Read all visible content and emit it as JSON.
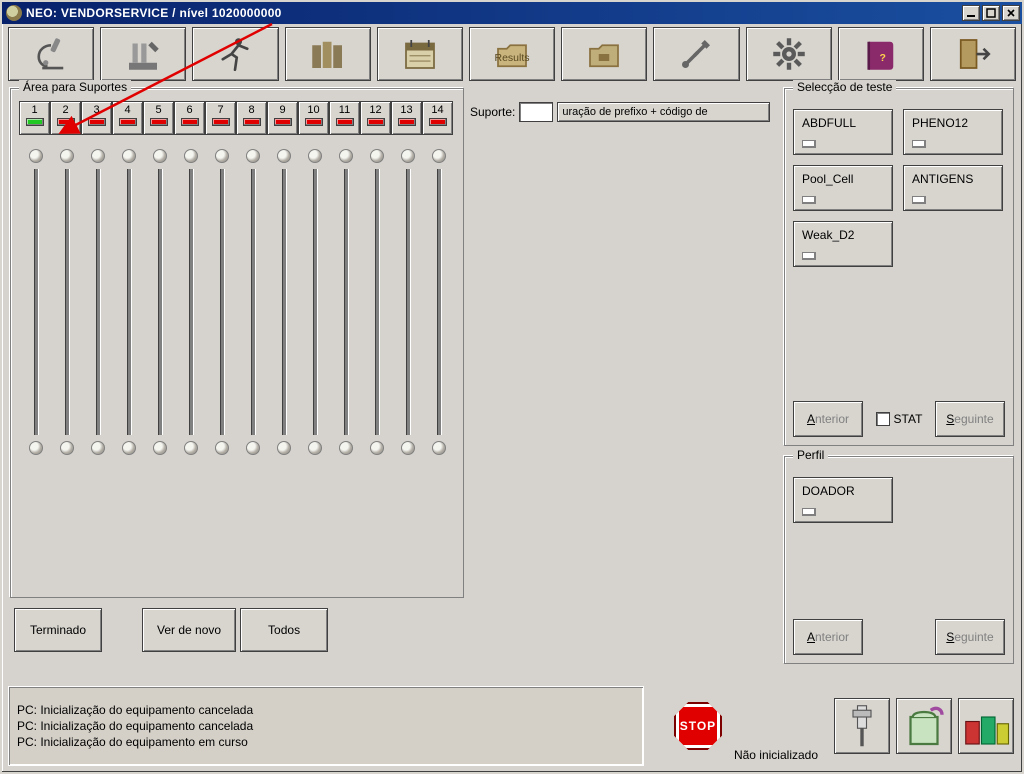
{
  "window": {
    "title": "NEO: VENDORSERVICE / nível 1020000000"
  },
  "toolbar": {
    "icons": [
      "microscope-icon",
      "pipette-icon",
      "runner-icon",
      "cassettes-icon",
      "calendar-icon",
      "results-folder-icon",
      "archive-icon",
      "tools-icon",
      "gear-icon",
      "help-book-icon",
      "exit-icon"
    ]
  },
  "racks": {
    "group_label": "Área para Suportes",
    "slots": [
      {
        "n": "1",
        "led": "green"
      },
      {
        "n": "2",
        "led": "red"
      },
      {
        "n": "3",
        "led": "red"
      },
      {
        "n": "4",
        "led": "red"
      },
      {
        "n": "5",
        "led": "red"
      },
      {
        "n": "6",
        "led": "red"
      },
      {
        "n": "7",
        "led": "red"
      },
      {
        "n": "8",
        "led": "red"
      },
      {
        "n": "9",
        "led": "red"
      },
      {
        "n": "10",
        "led": "red"
      },
      {
        "n": "11",
        "led": "red"
      },
      {
        "n": "12",
        "led": "red"
      },
      {
        "n": "13",
        "led": "red"
      },
      {
        "n": "14",
        "led": "red"
      }
    ],
    "btn_done": "Terminado",
    "btn_again": "Ver de novo",
    "btn_all": "Todos"
  },
  "suporte": {
    "label": "Suporte:",
    "value": "",
    "hint": "uração de prefixo + código de"
  },
  "tests": {
    "group_label": "Selecção de teste",
    "items": [
      "ABDFULL",
      "PHENO12",
      "Pool_Cell",
      "ANTIGENS",
      "Weak_D2"
    ],
    "prev_html": "<u>A</u>nterior",
    "next_html": "<u>S</u>eguinte",
    "stat_label": "STAT"
  },
  "perfil": {
    "group_label": "Perfil",
    "items": [
      "DOADOR"
    ],
    "prev_html": "<u>A</u>nterior",
    "next_html": "<u>S</u>eguinte"
  },
  "status": {
    "lines": [
      "PC: Inicialização do equipamento cancelada",
      "PC: Inicialização do equipamento cancelada",
      "PC: Inicialização do equipamento em curso"
    ],
    "stop": "STOP",
    "state": "Não inicializado"
  }
}
